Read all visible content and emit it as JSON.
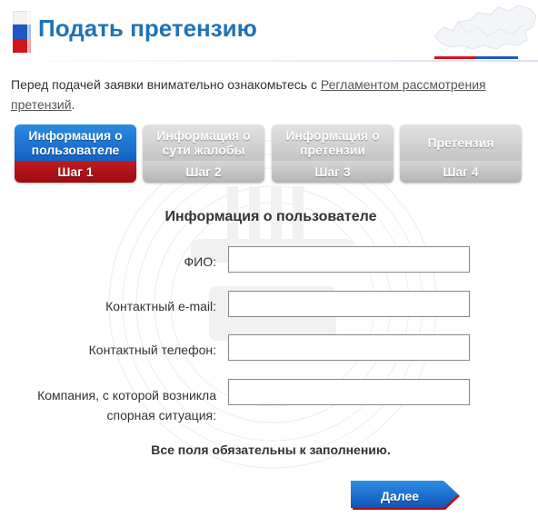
{
  "header": {
    "title": "Подать претензию"
  },
  "intro": {
    "text": "Перед подачей заявки внимательно ознакомьтесь с ",
    "link_text": "Регламентом рассмотрения претензий",
    "suffix": "."
  },
  "steps": [
    {
      "title": "Информация о пользователе",
      "step": "Шаг 1",
      "active": true
    },
    {
      "title": "Информация о сути жалобы",
      "step": "Шаг 2",
      "active": false
    },
    {
      "title": "Информация о претензии",
      "step": "Шаг 3",
      "active": false
    },
    {
      "title": "Претензия",
      "step": "Шаг 4",
      "active": false
    }
  ],
  "form": {
    "title": "Информация о пользователе",
    "fields": {
      "fio": {
        "label": "ФИО:",
        "value": ""
      },
      "email": {
        "label": "Контактный e-mail:",
        "value": ""
      },
      "phone": {
        "label": "Контактный телефон:",
        "value": ""
      },
      "company": {
        "label_line1": "Компания, с которой возникла",
        "label_line2": "спорная ситуация:",
        "value": ""
      }
    },
    "required_note": "Все поля обязательны к заполнению.",
    "next_label": "Далее"
  },
  "colors": {
    "title_blue": "#1e73b8",
    "active_step_blue": "#1362c4",
    "active_step_red": "#9e0b10",
    "inactive_step_gray": "#c4c4c4",
    "flag_white": "#f4f4f4",
    "flag_blue": "#1f57c4",
    "flag_red": "#d3131b"
  }
}
